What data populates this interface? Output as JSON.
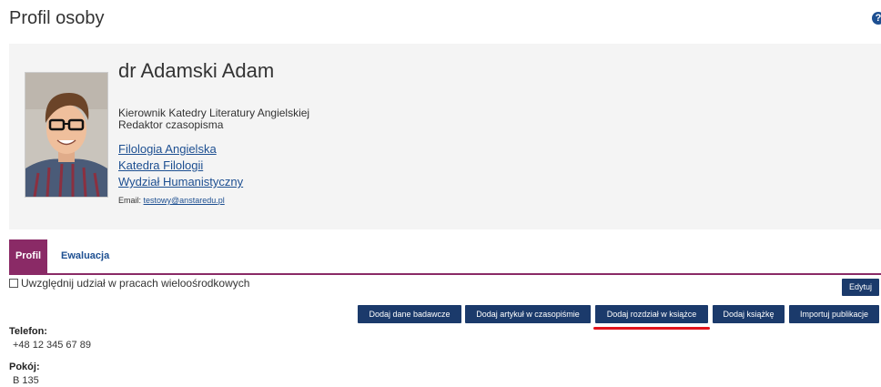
{
  "header": {
    "title": "Profil osoby",
    "help_icon": "?"
  },
  "profile": {
    "name": "dr Adamski Adam",
    "positions": [
      "Kierownik Katedry Literatury Angielskiej",
      "Redaktor czasopisma"
    ],
    "units": [
      "Filologia Angielska",
      "Katedra Filologii",
      "Wydział Humanistyczny"
    ],
    "email_label": "Email:",
    "email": "testowy@anstaredu.pl"
  },
  "tabs": [
    {
      "label": "Profil",
      "active": true
    },
    {
      "label": "Ewaluacja",
      "active": false
    }
  ],
  "multicenter_label": "Uwzględnij udział w pracach wieloośrodkowych",
  "edit_label": "Edytuj",
  "actions": [
    "Dodaj dane badawcze",
    "Dodaj artykuł w czasopiśmie",
    "Dodaj rozdział w książce",
    "Dodaj książkę",
    "Importuj publikacje"
  ],
  "fields": [
    {
      "label": "Telefon:",
      "value": "+48 12 345 67 89"
    },
    {
      "label": "Pokój:",
      "value": "B 135"
    }
  ],
  "colors": {
    "accent": "#8a2a66",
    "button": "#1b3a6b",
    "link": "#1d4f91",
    "highlight": "#e3141c"
  }
}
